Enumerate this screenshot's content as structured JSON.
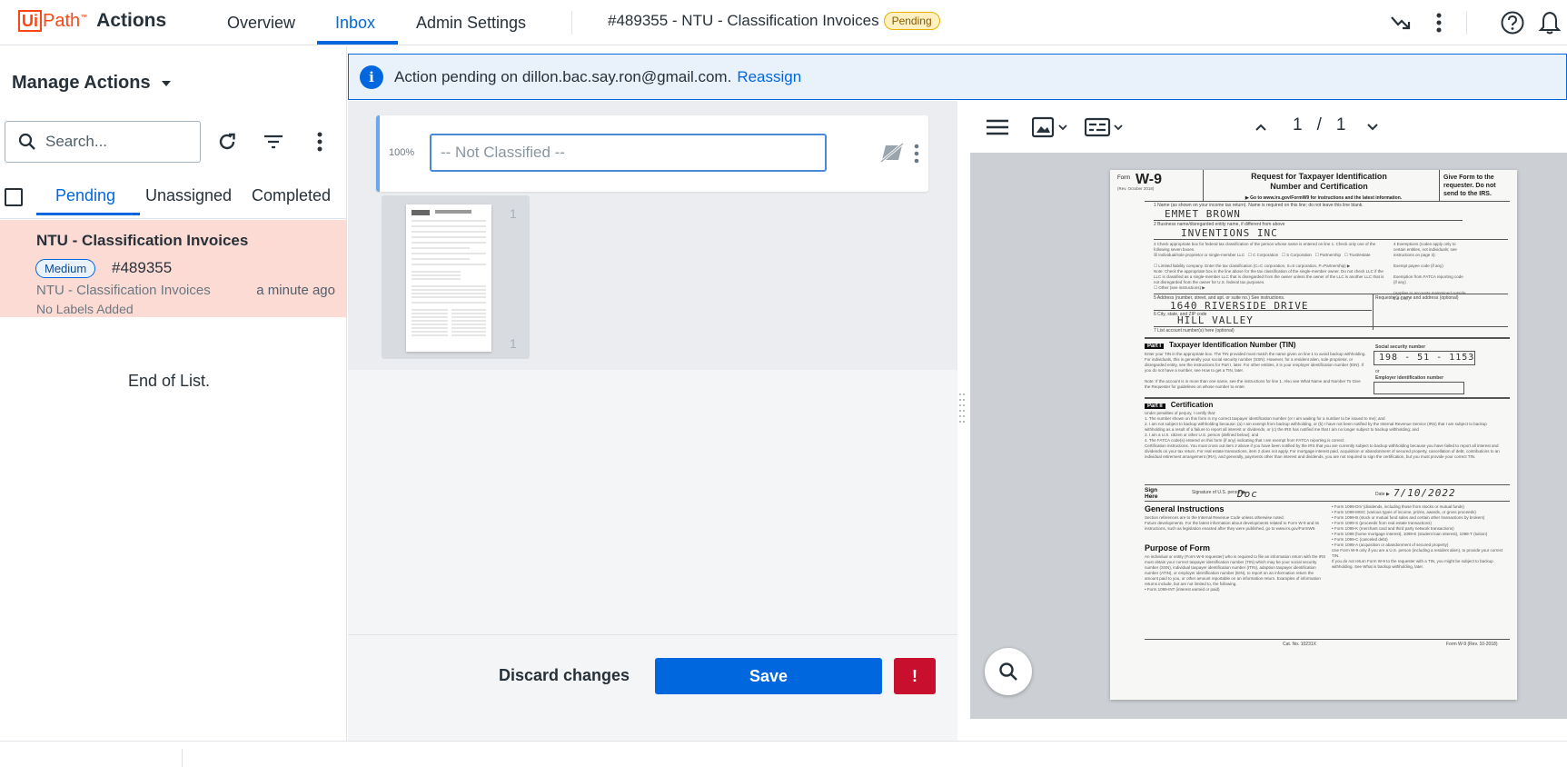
{
  "app": {
    "logo_ui": "Ui",
    "logo_path": "Path",
    "logo_tm": "™",
    "name": "Actions"
  },
  "nav": {
    "tabs": [
      {
        "label": "Overview",
        "active": false
      },
      {
        "label": "Inbox",
        "active": true
      },
      {
        "label": "Admin Settings",
        "active": false
      }
    ],
    "task_title": "#489355 - NTU - Classification Invoices",
    "task_status": "Pending",
    "icons": [
      "trend-icon",
      "more-vert-icon",
      "help-icon",
      "bell-icon"
    ]
  },
  "sidebar": {
    "title": "Manage Actions",
    "search_placeholder": "Search...",
    "tabs": [
      {
        "label": "Pending",
        "active": true
      },
      {
        "label": "Unassigned",
        "active": false
      },
      {
        "label": "Completed",
        "active": false
      }
    ],
    "tasks": [
      {
        "title": "NTU - Classification Invoices",
        "priority": "Medium",
        "id": "#489355",
        "catalog": "NTU - Classification Invoices",
        "time": "a minute ago",
        "labels": "No Labels Added"
      }
    ],
    "end_text": "End of List."
  },
  "banner": {
    "text": "Action pending on dillon.bac.say.ron@gmail.com.",
    "link": "Reassign",
    "accent": "#0067df"
  },
  "classifier": {
    "confidence": "100%",
    "placeholder": "-- Not Classified --",
    "thumb_page_top": "1",
    "thumb_page_bottom": "1"
  },
  "actions": {
    "discard": "Discard changes",
    "save": "Save",
    "alert": "!"
  },
  "viewer": {
    "page_current": "1",
    "page_separator": "/",
    "page_total": "1"
  },
  "document": {
    "form_label": "Form",
    "form_name": "W-9",
    "rev": "(Rev. October 2018)",
    "title": "Request for Taxpayer Identification Number and Certification",
    "instructions_link": "▶ Go to www.irs.gov/FormW9 for instructions and the latest information.",
    "give_form": "Give Form to the requester. Do not send to the IRS.",
    "name": "EMMET BROWN",
    "business": "INVENTIONS INC",
    "address": "1640 RIVERSIDE DRIVE",
    "city": "HILL VALLEY",
    "part1": "Part I",
    "part1_title": "Taxpayer Identification Number (TIN)",
    "ssn_label": "Social security number",
    "ssn": "198 - 51 - 1153",
    "ein_label": "Employer identification number",
    "part2": "Part II",
    "part2_title": "Certification",
    "sign_here": "Sign Here",
    "signature": "Doc",
    "date": "7/10/2022",
    "general": "General Instructions",
    "purpose": "Purpose of Form",
    "cat_no": "Cat. No. 10231X",
    "footer_form": "Form W-9 (Rev. 10-2018)"
  }
}
